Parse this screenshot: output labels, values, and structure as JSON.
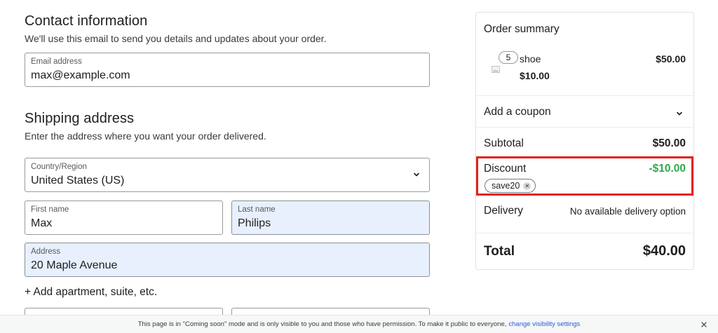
{
  "contact": {
    "title": "Contact information",
    "subtitle": "We'll use this email to send you details and updates about your order.",
    "email_label": "Email address",
    "email_value": "max@example.com"
  },
  "shipping": {
    "title": "Shipping address",
    "subtitle": "Enter the address where you want your order delivered.",
    "country_label": "Country/Region",
    "country_value": "United States (US)",
    "first_name_label": "First name",
    "first_name_value": "Max",
    "last_name_label": "Last name",
    "last_name_value": "Philips",
    "address_label": "Address",
    "address_value": "20 Maple Avenue",
    "add_apartment": "+ Add apartment, suite, etc."
  },
  "summary": {
    "title": "Order summary",
    "item": {
      "quantity": "5",
      "name": "shoe",
      "unit_price": "$10.00",
      "line_total": "$50.00",
      "thumbnail_icon": "image-placeholder-icon"
    },
    "coupon_label": "Add a coupon",
    "subtotal_label": "Subtotal",
    "subtotal_value": "$50.00",
    "discount_label": "Discount",
    "discount_value": "-$10.00",
    "coupon_code": "save20",
    "delivery_label": "Delivery",
    "delivery_value": "No available delivery option",
    "total_label": "Total",
    "total_value": "$40.00"
  },
  "banner": {
    "text": "This page is in \"Coming soon\" mode and is only visible to you and those who have permission. To make it public to everyone,",
    "link": "change visibility settings"
  },
  "colors": {
    "highlight_border": "#e2231a",
    "discount_green": "#2eaa4a",
    "autofill_bg": "#e8f0fe",
    "link_blue": "#2a5bd7"
  }
}
